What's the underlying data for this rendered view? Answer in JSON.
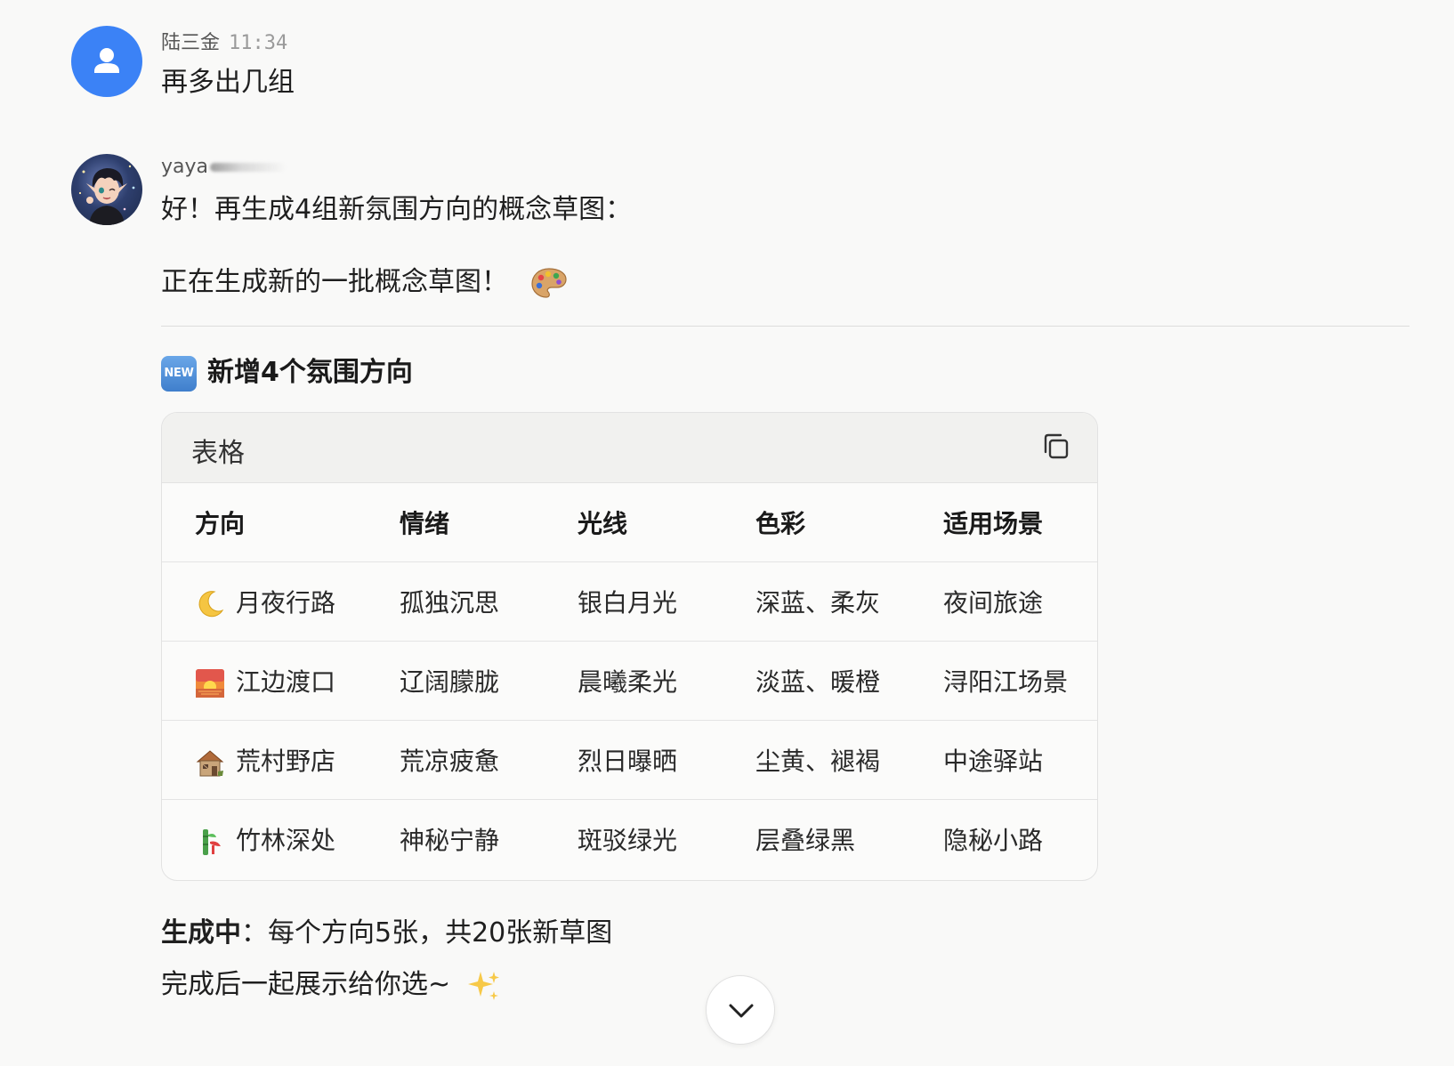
{
  "messages": {
    "user": {
      "name": "陆三金",
      "time": "11:34",
      "text": "再多出几组"
    },
    "bot": {
      "name": "yaya",
      "line1": "好！再生成4组新氛围方向的概念草图：",
      "line2": "正在生成新的一批概念草图！",
      "line2_emoji": "palette-emoji",
      "section_title": "新增4个氛围方向",
      "section_badge": "NEW",
      "table": {
        "title": "表格",
        "copy_icon": "copy-icon",
        "headers": [
          "方向",
          "情绪",
          "光线",
          "色彩",
          "适用场景"
        ],
        "rows": [
          {
            "emoji": "crescent-moon-emoji",
            "cells": [
              "月夜行路",
              "孤独沉思",
              "银白月光",
              "深蓝、柔灰",
              "夜间旅途"
            ]
          },
          {
            "emoji": "sunrise-emoji",
            "cells": [
              "江边渡口",
              "辽阔朦胧",
              "晨曦柔光",
              "淡蓝、暖橙",
              "浔阳江场景"
            ]
          },
          {
            "emoji": "derelict-house-emoji",
            "cells": [
              "荒村野店",
              "荒凉疲惫",
              "烈日曝晒",
              "尘黄、褪褐",
              "中途驿站"
            ]
          },
          {
            "emoji": "bamboo-emoji",
            "cells": [
              "竹林深处",
              "神秘宁静",
              "斑驳绿光",
              "层叠绿黑",
              "隐秘小路"
            ]
          }
        ]
      },
      "footer_label": "生成中",
      "footer_sep": "：",
      "footer_text": "每个方向5张，共20张新草图",
      "footer_line2": "完成后一起展示给你选~",
      "footer_emoji": "sparkles-emoji"
    }
  },
  "scroll_button": {
    "icon": "chevron-down-icon"
  },
  "colors": {
    "background": "#f9f9f8",
    "user_avatar": "#3b82f6",
    "table_header_bg": "#f1f1ef",
    "border": "#e2e2e2"
  }
}
